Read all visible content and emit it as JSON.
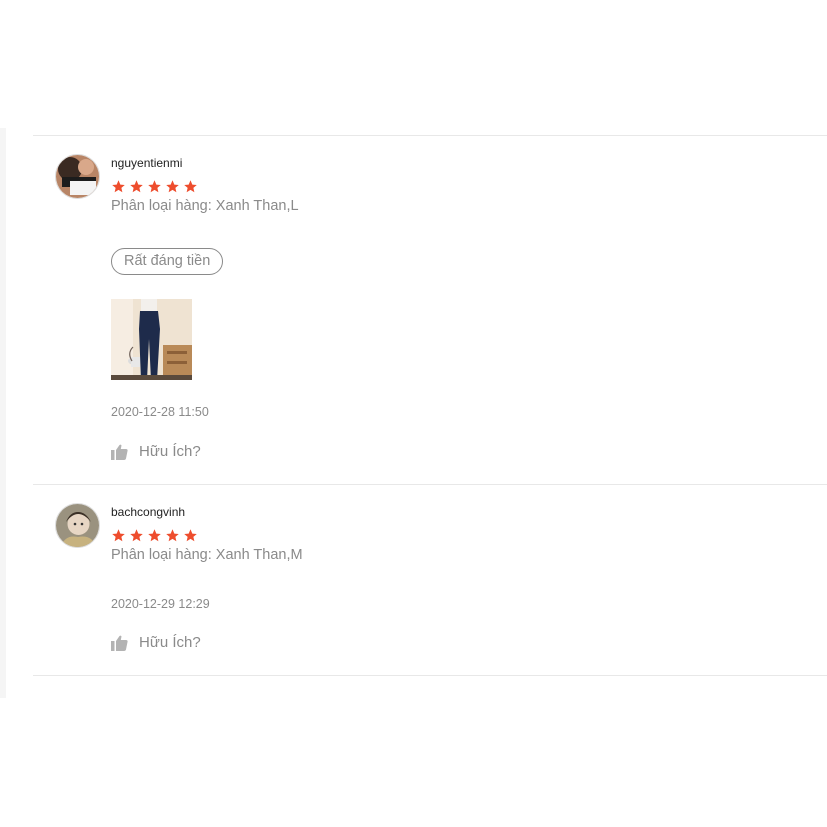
{
  "colors": {
    "star": "#ee4d2d",
    "muted_text": "#8a8a8a",
    "divider": "#e8e8e8"
  },
  "reviews": [
    {
      "username": "nguyentienmi",
      "rating": 5,
      "variation": "Phân loại hàng: Xanh Than,L",
      "tag": "Rất đáng tiền",
      "timestamp": "2020-12-28 11:50",
      "helpful_label": "Hữu Ích?"
    },
    {
      "username": "bachcongvinh",
      "rating": 5,
      "variation": "Phân loại hàng: Xanh Than,M",
      "timestamp": "2020-12-29 12:29",
      "helpful_label": "Hữu Ích?"
    }
  ],
  "icons": {
    "star": "star-icon",
    "helpful": "thumbs-up-icon"
  }
}
